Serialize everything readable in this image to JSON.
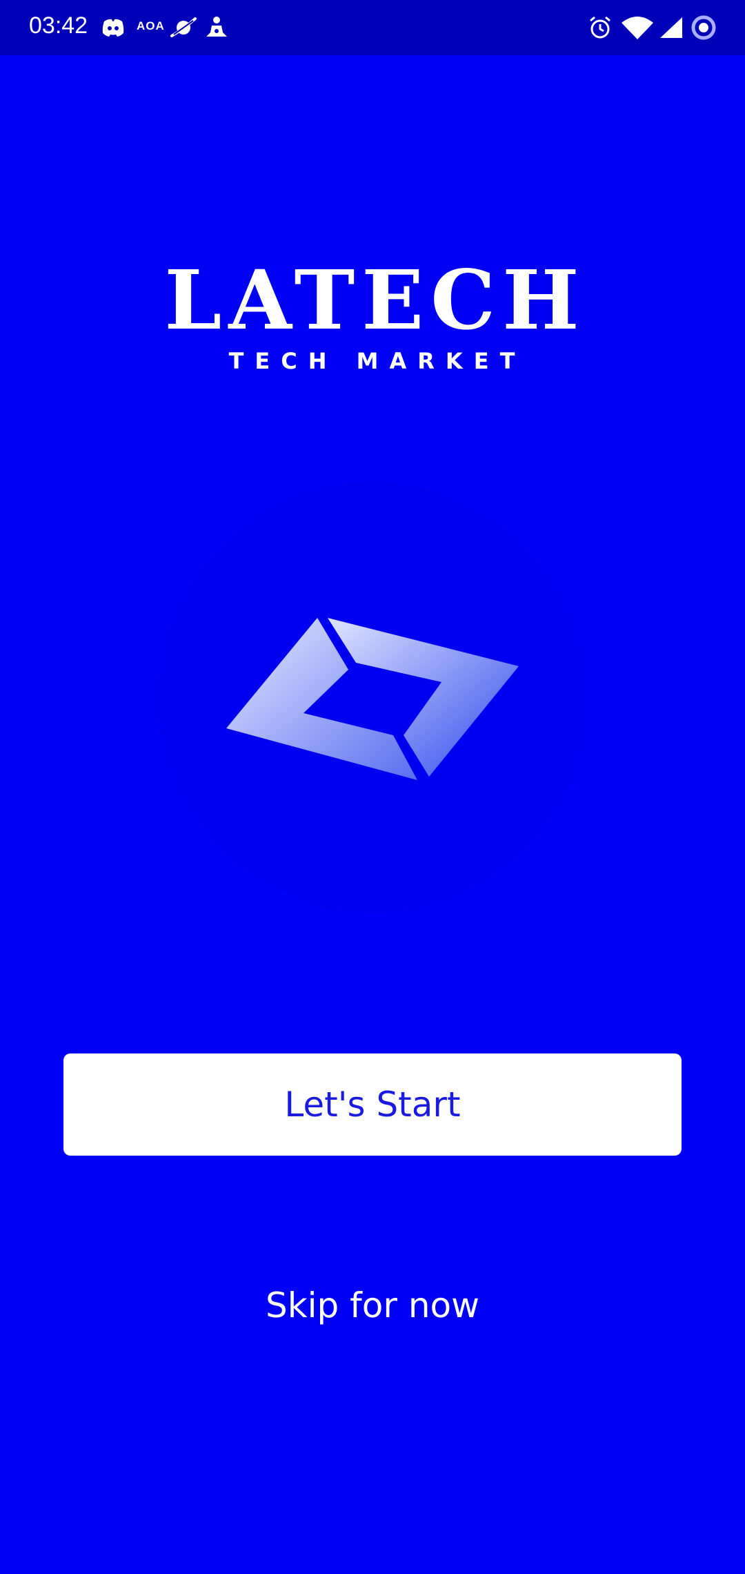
{
  "status_bar": {
    "time": "03:42",
    "aoa_label": "AOA",
    "icons_left": [
      "discord-icon",
      "aoa-icon",
      "planet-icon",
      "person-icon"
    ],
    "icons_right": [
      "alarm-icon",
      "wifi-icon",
      "signal-icon",
      "record-icon"
    ]
  },
  "brand": {
    "title": "LATECH",
    "subtitle": "TECH MARKET"
  },
  "actions": {
    "start_label": "Let's Start",
    "skip_label": "Skip for now"
  },
  "colors": {
    "background": "#0000f5",
    "status_bar": "#0000b8",
    "button_text": "#1a1ae0",
    "button_bg": "#ffffff"
  }
}
